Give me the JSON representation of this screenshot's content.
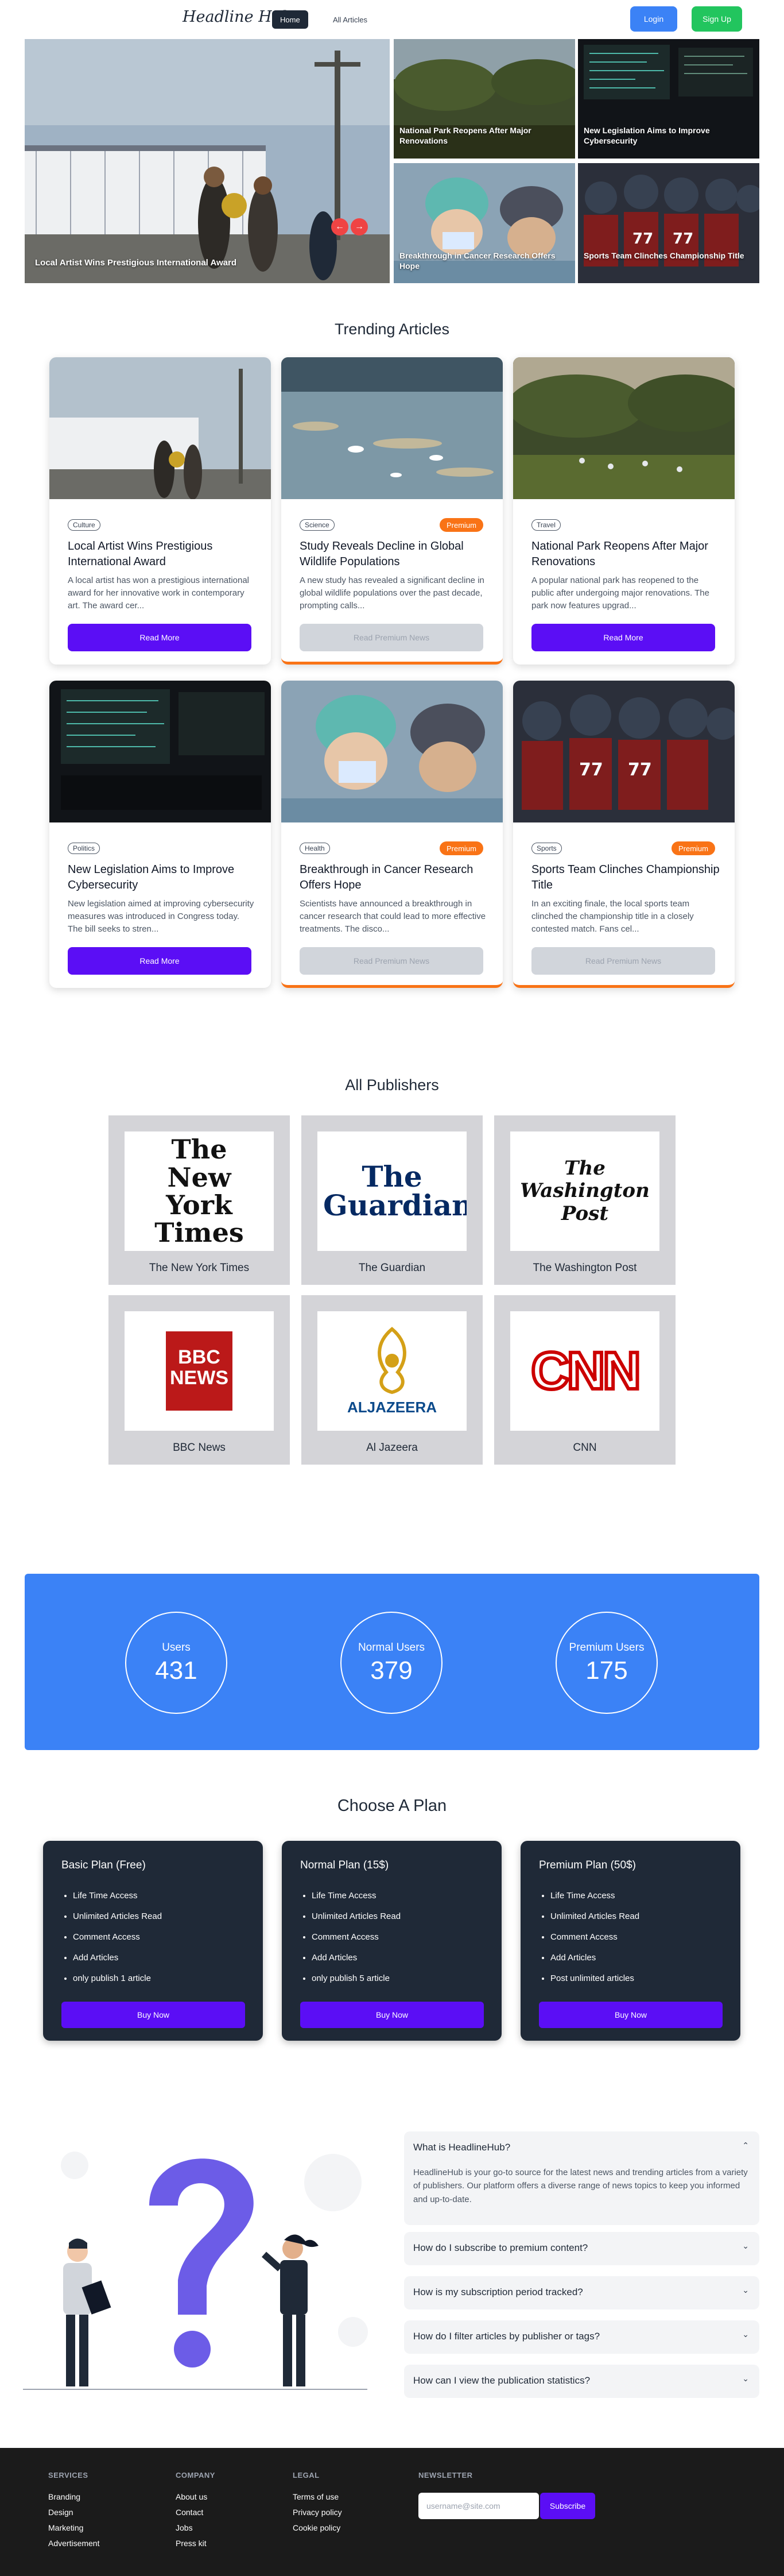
{
  "header": {
    "logo": "Headline Hub",
    "nav": [
      "Home",
      "All Articles"
    ],
    "login": "Login",
    "signup": "Sign Up"
  },
  "hero": {
    "main_caption": "Local Artist Wins Prestigious International Award",
    "tiles": [
      "National Park Reopens After Major Renovations",
      "New Legislation Aims to Improve Cybersecurity",
      "Breakthrough in Cancer Research Offers Hope",
      "Sports Team Clinches Championship Title"
    ],
    "prev_icon": "←",
    "next_icon": "→"
  },
  "trending": {
    "title": "Trending Articles",
    "premium_label": "Premium",
    "articles": [
      {
        "tag": "Culture",
        "title": "Local Artist Wins Prestigious International Award",
        "excerpt": "A local artist has won a prestigious international award for her innovative work in contemporary art. The award cer...",
        "button": "Read More",
        "premium": false
      },
      {
        "tag": "Science",
        "title": "Study Reveals Decline in Global Wildlife Populations",
        "excerpt": "A new study has revealed a significant decline in global wildlife populations over the past decade, prompting calls...",
        "button": "Read Premium News",
        "premium": true
      },
      {
        "tag": "Travel",
        "title": "National Park Reopens After Major Renovations",
        "excerpt": "A popular national park has reopened to the public after undergoing major renovations. The park now features upgrad...",
        "button": "Read More",
        "premium": false
      },
      {
        "tag": "Politics",
        "title": "New Legislation Aims to Improve Cybersecurity",
        "excerpt": "New legislation aimed at improving cybersecurity measures was introduced in Congress today. The bill seeks to stren...",
        "button": "Read More",
        "premium": false
      },
      {
        "tag": "Health",
        "title": "Breakthrough in Cancer Research Offers Hope",
        "excerpt": "Scientists have announced a breakthrough in cancer research that could lead to more effective treatments. The disco...",
        "button": "Read Premium News",
        "premium": true
      },
      {
        "tag": "Sports",
        "title": "Sports Team Clinches Championship Title",
        "excerpt": "In an exciting finale, the local sports team clinched the championship title in a closely contested match. Fans cel...",
        "button": "Read Premium News",
        "premium": true
      }
    ]
  },
  "publishers": {
    "title": "All Publishers",
    "items": [
      {
        "name": "The New York Times",
        "logo": "The New York Times"
      },
      {
        "name": "The Guardian",
        "logo": "The Guardian"
      },
      {
        "name": "The Washington Post",
        "logo": "The Washington Post"
      },
      {
        "name": "BBC News",
        "logo": "BBC NEWS"
      },
      {
        "name": "Al Jazeera",
        "logo": "ALJAZEERA"
      },
      {
        "name": "CNN",
        "logo": "CNN"
      }
    ]
  },
  "stats": [
    {
      "label": "Users",
      "value": "431"
    },
    {
      "label": "Normal Users",
      "value": "379"
    },
    {
      "label": "Premium Users",
      "value": "175"
    }
  ],
  "plans": {
    "title": "Choose A Plan",
    "items": [
      {
        "name": "Basic Plan (Free)",
        "features": [
          "Life Time Access",
          "Unlimited Articles Read",
          "Comment Access",
          "Add Articles",
          "only publish 1 article"
        ],
        "button": "Buy Now"
      },
      {
        "name": "Normal Plan (15$)",
        "features": [
          "Life Time Access",
          "Unlimited Articles Read",
          "Comment Access",
          "Add Articles",
          "only publish 5 article"
        ],
        "button": "Buy Now"
      },
      {
        "name": "Premium Plan (50$)",
        "features": [
          "Life Time Access",
          "Unlimited Articles Read",
          "Comment Access",
          "Add Articles",
          "Post unlimited articles"
        ],
        "button": "Buy Now"
      }
    ]
  },
  "faq": [
    {
      "q": "What is HeadlineHub?",
      "a": "HeadlineHub is your go-to source for the latest news and trending articles from a variety of publishers. Our platform offers a diverse range of news topics to keep you informed and up-to-date.",
      "open": true
    },
    {
      "q": "How do I subscribe to premium content?",
      "open": false
    },
    {
      "q": "How is my subscription period tracked?",
      "open": false
    },
    {
      "q": "How do I filter articles by publisher or tags?",
      "open": false
    },
    {
      "q": "How can I view the publication statistics?",
      "open": false
    }
  ],
  "footer": {
    "columns": [
      {
        "heading": "SERVICES",
        "links": [
          "Branding",
          "Design",
          "Marketing",
          "Advertisement"
        ]
      },
      {
        "heading": "COMPANY",
        "links": [
          "About us",
          "Contact",
          "Jobs",
          "Press kit"
        ]
      },
      {
        "heading": "LEGAL",
        "links": [
          "Terms of use",
          "Privacy policy",
          "Cookie policy"
        ]
      }
    ],
    "newsletter": {
      "heading": "NEWSLETTER",
      "placeholder": "username@site.com",
      "button": "Subscribe"
    }
  },
  "colors": {
    "primary": "#5b0ef5",
    "login": "#3b82f6",
    "signup": "#22c55e",
    "premium": "#f97316",
    "stats_bg": "#3b82f6",
    "plan_bg": "#1f2937",
    "footer_bg": "#1b1b1b"
  }
}
